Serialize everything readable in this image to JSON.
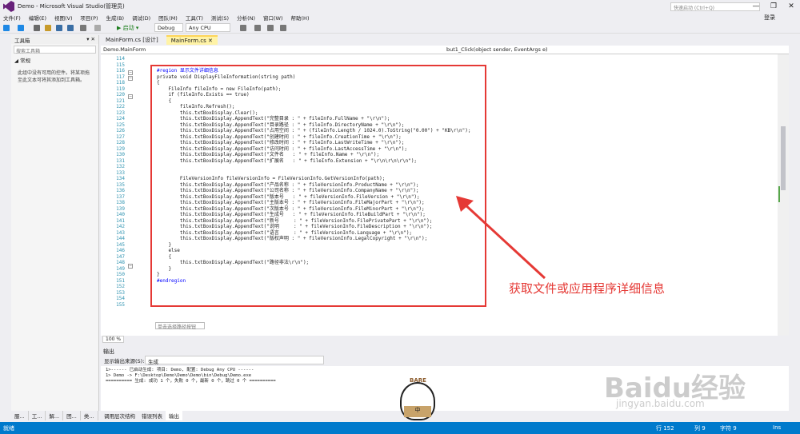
{
  "window": {
    "title": "Demo - Microsoft Visual Studio(管理员)",
    "quick_launch": "快速启动 (Ctrl+Q)",
    "login": "登录",
    "min": "—",
    "max": "❐",
    "close": "✕"
  },
  "menu": [
    "文件(F)",
    "编辑(E)",
    "视图(V)",
    "项目(P)",
    "生成(B)",
    "调试(D)",
    "团队(M)",
    "工具(T)",
    "测试(S)",
    "分析(N)",
    "窗口(W)",
    "帮助(H)"
  ],
  "toolbar": {
    "start": "▶ 启动 ▾",
    "config": "Debug",
    "platform": "Any CPU"
  },
  "toolbox": {
    "title": "工具箱",
    "search": "搜索工具箱",
    "group": "◢ 常规",
    "message": "此组中没有可用的控件。将某项拖至此文本可将其添加到工具箱。",
    "tabs": [
      "服...",
      "工...",
      "解...",
      "团...",
      "类..."
    ]
  },
  "doc_tabs": [
    {
      "label": "MainForm.cs [设计]"
    },
    {
      "label": "MainForm.cs ✕"
    }
  ],
  "nav": {
    "class": "Demo.MainForm",
    "member": "but1_Click(object sender, EventArgs e)"
  },
  "line_numbers": [
    "114",
    "115",
    "116",
    "117",
    "118",
    "119",
    "120",
    "121",
    "122",
    "123",
    "124",
    "125",
    "126",
    "127",
    "128",
    "129",
    "130",
    "131",
    "132",
    "133",
    "134",
    "135",
    "136",
    "137",
    "138",
    "139",
    "140",
    "141",
    "142",
    "143",
    "144",
    "145",
    "146",
    "147",
    "148",
    "149",
    "150",
    "151",
    "152",
    "153",
    "154",
    "155"
  ],
  "code_lines": [
    "",
    "",
    "#region 显示文件详细信息",
    "private void DisplayFileInformation(string path)",
    "{",
    "    FileInfo fileInfo = new FileInfo(path);",
    "    if (fileInfo.Exists == true)",
    "    {",
    "        fileInfo.Refresh();",
    "        this.txtBoxDisplay.Clear();",
    "        this.txtBoxDisplay.AppendText(\"完整目录 : \" + fileInfo.FullName + \"\\r\\n\");",
    "        this.txtBoxDisplay.AppendText(\"目录路径 : \" + fileInfo.DirectoryName + \"\\r\\n\");",
    "        this.txtBoxDisplay.AppendText(\"占用空间 : \" + (fileInfo.Length / 1024.0).ToString(\"0.00\") + \"KB\\r\\n\");",
    "        this.txtBoxDisplay.AppendText(\"创建时间 : \" + fileInfo.CreationTime + \"\\r\\n\");",
    "        this.txtBoxDisplay.AppendText(\"修改时间 : \" + fileInfo.LastWriteTime + \"\\r\\n\");",
    "        this.txtBoxDisplay.AppendText(\"访问时间 : \" + fileInfo.LastAccessTime + \"\\r\\n\");",
    "        this.txtBoxDisplay.AppendText(\"文件名   : \" + fileInfo.Name + \"\\r\\n\");",
    "        this.txtBoxDisplay.AppendText(\"扩展名   : \" + fileInfo.Extension + \"\\r\\n\\r\\n\\r\\n\");",
    "",
    "",
    "        FileVersionInfo fileVersionInfo = FileVersionInfo.GetVersionInfo(path);",
    "        this.txtBoxDisplay.AppendText(\"产品名称 : \" + fileVersionInfo.ProductName + \"\\r\\n\");",
    "        this.txtBoxDisplay.AppendText(\"公司名称 : \" + fileVersionInfo.CompanyName + \"\\r\\n\");",
    "        this.txtBoxDisplay.AppendText(\"版本号   : \" + fileVersionInfo.FileVersion + \"\\r\\n\");",
    "        this.txtBoxDisplay.AppendText(\"主版本号 : \" + fileVersionInfo.FileMajorPart + \"\\r\\n\");",
    "        this.txtBoxDisplay.AppendText(\"次版本号 : \" + fileVersionInfo.FileMinorPart + \"\\r\\n\");",
    "        this.txtBoxDisplay.AppendText(\"生成号   : \" + fileVersionInfo.FileBuildPart + \"\\r\\n\");",
    "        this.txtBoxDisplay.AppendText(\"新号     : \" + fileVersionInfo.FilePrivatePart + \"\\r\\n\");",
    "        this.txtBoxDisplay.AppendText(\"说明     : \" + fileVersionInfo.FileDescription + \"\\r\\n\");",
    "        this.txtBoxDisplay.AppendText(\"语言     : \" + fileVersionInfo.Language + \"\\r\\n\");",
    "        this.txtBoxDisplay.AppendText(\"版权声明 : \" + fileVersionInfo.LegalCopyright + \"\\r\\n\");",
    "    }",
    "    else",
    "    {",
    "        this.txtBoxDisplay.AppendText(\"路径非法\\r\\n\");",
    "    }",
    "}",
    "#endregion",
    "",
    "",
    "",
    ""
  ],
  "find_box": "单击选择路径按钮",
  "annotation": "获取文件或应用程序详细信息",
  "zoom": "100 %",
  "output": {
    "title": "输出",
    "source_label": "显示输出来源(S):",
    "source": "生成",
    "lines": [
      "1>------ 已启动生成: 项目: Demo, 配置: Debug Any CPU ------",
      "1>  Demo -> F:\\Desktop\\Demo\\Demo\\Demo\\bin\\Debug\\Demo.exe",
      "========== 生成: 成功 1 个，失败 0 个，最新 0 个，跳过 0 个 =========="
    ]
  },
  "output_tabs": [
    "调用层次结构",
    "错误列表",
    "输出"
  ],
  "status": {
    "ready": "就绪",
    "row": "行 152",
    "col": "列 9",
    "char": "字符 9",
    "ins": "Ins"
  },
  "watermark": "Baidu经验",
  "watermark2": "jingyan.baidu.com",
  "bear_sign": "中",
  "bear_badge": "BARE"
}
